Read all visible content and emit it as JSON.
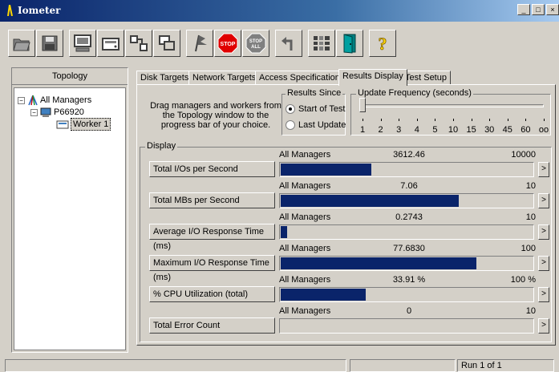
{
  "window": {
    "title": "Iometer",
    "buttons": [
      "_",
      "□",
      "×"
    ]
  },
  "toolbar": {
    "buttons": [
      "open-icon",
      "save-icon",
      "new-manager-icon",
      "new-disk-worker-icon",
      "new-network-worker-icon",
      "copy-worker-icon",
      "start-icon",
      "stop-icon",
      "stop-all-icon",
      "reset-icon",
      "exit-icon",
      "about-icon"
    ],
    "stop_label": "STOP",
    "stop_all_label_1": "STOP",
    "stop_all_label_2": "ALL",
    "help_label": "?"
  },
  "topology": {
    "header": "Topology",
    "root": "All Managers",
    "manager": "P66920",
    "worker": "Worker 1",
    "expander": "−"
  },
  "tabs": [
    {
      "label": "Disk Targets"
    },
    {
      "label": "Network Targets"
    },
    {
      "label": "Access Specifications"
    },
    {
      "label": "Results Display",
      "active": true
    },
    {
      "label": "Test Setup"
    }
  ],
  "results_panel": {
    "drag_hint": "Drag managers and workers from the Topology window to the progress bar of your choice.",
    "results_since": {
      "legend": "Results Since",
      "options": [
        "Start of Test",
        "Last Update"
      ],
      "selected": "Start of Test"
    },
    "update_frequency": {
      "legend": "Update Frequency (seconds)",
      "ticks": [
        "1",
        "2",
        "3",
        "4",
        "5",
        "10",
        "15",
        "30",
        "45",
        "60",
        "oo"
      ],
      "value": "1"
    },
    "display_legend": "Display"
  },
  "metrics": [
    {
      "button": "Total I/Os per Second",
      "scope": "All Managers",
      "value": "3612.46",
      "max": "10000",
      "fraction": 0.361
    },
    {
      "button": "Total MBs per Second",
      "scope": "All Managers",
      "value": "7.06",
      "max": "10",
      "fraction": 0.706
    },
    {
      "button": "Average I/O Response Time (ms)",
      "scope": "All Managers",
      "value": "0.2743",
      "max": "10",
      "fraction": 0.027
    },
    {
      "button": "Maximum I/O Response Time (ms)",
      "scope": "All Managers",
      "value": "77.6830",
      "max": "100",
      "fraction": 0.777
    },
    {
      "button": "% CPU Utilization (total)",
      "scope": "All Managers",
      "value": "33.91 %",
      "max": "100 %",
      "fraction": 0.339
    },
    {
      "button": "Total Error Count",
      "scope": "All Managers",
      "value": "0",
      "max": "10",
      "fraction": 0
    }
  ],
  "arrow_label": ">",
  "status": {
    "run": "Run 1 of 1"
  },
  "colors": {
    "bar": "#0a246a",
    "title_start": "#0a246a",
    "title_end": "#a6caf0"
  }
}
